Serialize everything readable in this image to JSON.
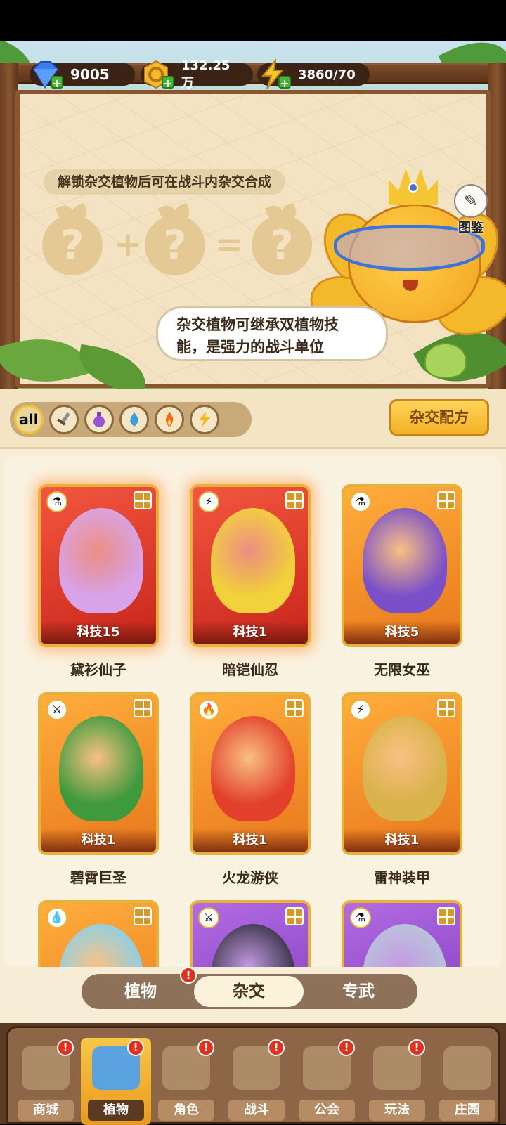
{
  "resources": {
    "gems": "9005",
    "coins": "132.25万",
    "energy": "3860/70"
  },
  "hero": {
    "unlock_text": "解锁杂交植物后可在战斗内杂交合成",
    "question_mark": "?",
    "plus": "+",
    "equals": "=",
    "speech_line1": "杂交植物可继承双植物技",
    "speech_line2": "能，是强力的战斗单位",
    "tujian_label": "图鉴"
  },
  "filters": {
    "all_label": "all",
    "icons": [
      "sword-icon",
      "potion-icon",
      "water-drop-icon",
      "fire-icon",
      "lightning-icon"
    ],
    "recipe_button": "杂交配方"
  },
  "cards": [
    {
      "name": "黛衫仙子",
      "tech": "科技15",
      "element": "potion",
      "color": "red"
    },
    {
      "name": "暗铠仙忍",
      "tech": "科技1",
      "element": "lightning",
      "color": "red"
    },
    {
      "name": "无限女巫",
      "tech": "科技5",
      "element": "potion",
      "color": "orange"
    },
    {
      "name": "碧霄巨圣",
      "tech": "科技1",
      "element": "sword",
      "color": "orange"
    },
    {
      "name": "火龙游侠",
      "tech": "科技1",
      "element": "fire",
      "color": "orange"
    },
    {
      "name": "雷神装甲",
      "tech": "科技1",
      "element": "lightning",
      "color": "orange"
    },
    {
      "element": "water",
      "color": "orange"
    },
    {
      "element": "sword",
      "color": "purple"
    },
    {
      "element": "potion",
      "color": "purple"
    }
  ],
  "segment_tabs": {
    "plants": "植物",
    "hybrid": "杂交",
    "exclusive": "专武",
    "badge": "!"
  },
  "bottom_nav": [
    {
      "label": "商城",
      "badge": "!"
    },
    {
      "label": "植物",
      "badge": "!"
    },
    {
      "label": "角色",
      "badge": "!"
    },
    {
      "label": "战斗",
      "badge": "!"
    },
    {
      "label": "公会",
      "badge": "!"
    },
    {
      "label": "玩法",
      "badge": "!"
    },
    {
      "label": "庄园",
      "badge": ""
    }
  ],
  "colors": {
    "accent_gold": "#f2b126",
    "wood": "#8a5630",
    "badge_red": "#e0321e"
  }
}
